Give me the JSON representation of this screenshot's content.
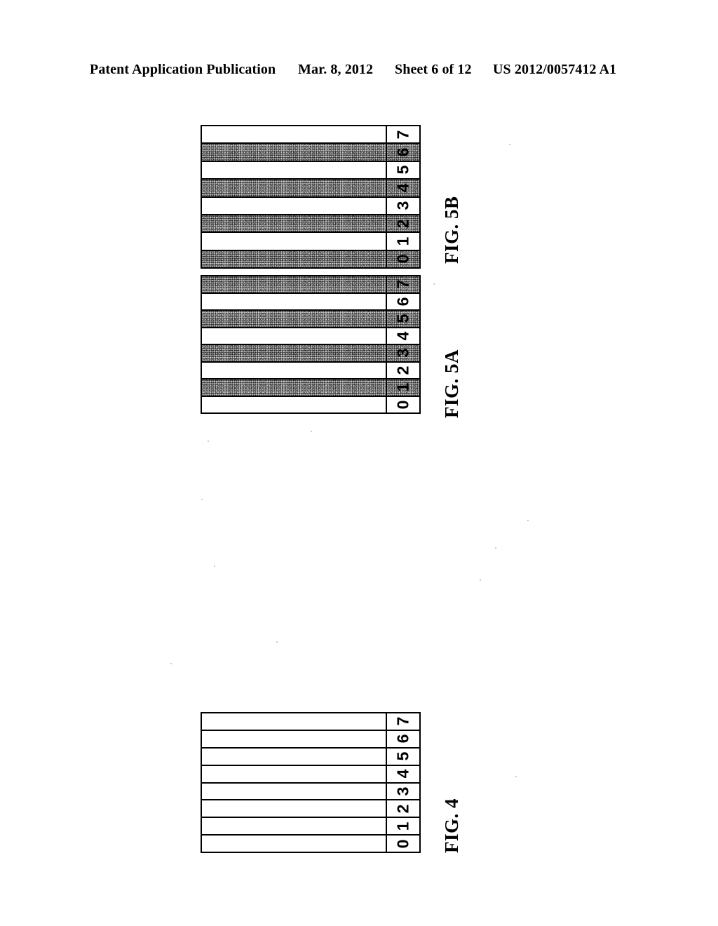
{
  "header": {
    "publication": "Patent Application Publication",
    "date": "Mar. 8, 2012",
    "sheet": "Sheet 6 of 12",
    "doc_number": "US 2012/0057412 A1"
  },
  "figures": [
    {
      "id": "fig-5b",
      "caption": "FIG. 5B",
      "rows": [
        {
          "label": "7",
          "shaded": false
        },
        {
          "label": "6",
          "shaded": true
        },
        {
          "label": "5",
          "shaded": false
        },
        {
          "label": "4",
          "shaded": true
        },
        {
          "label": "3",
          "shaded": false
        },
        {
          "label": "2",
          "shaded": true
        },
        {
          "label": "1",
          "shaded": false
        },
        {
          "label": "0",
          "shaded": true
        }
      ]
    },
    {
      "id": "fig-5a",
      "caption": "FIG. 5A",
      "rows": [
        {
          "label": "7",
          "shaded": true
        },
        {
          "label": "6",
          "shaded": false
        },
        {
          "label": "5",
          "shaded": true
        },
        {
          "label": "4",
          "shaded": false
        },
        {
          "label": "3",
          "shaded": true
        },
        {
          "label": "2",
          "shaded": false
        },
        {
          "label": "1",
          "shaded": true
        },
        {
          "label": "0",
          "shaded": false
        }
      ]
    },
    {
      "id": "fig-4",
      "caption": "FIG. 4",
      "rows": [
        {
          "label": "7",
          "shaded": false
        },
        {
          "label": "6",
          "shaded": false
        },
        {
          "label": "5",
          "shaded": false
        },
        {
          "label": "4",
          "shaded": false
        },
        {
          "label": "3",
          "shaded": false
        },
        {
          "label": "2",
          "shaded": false
        },
        {
          "label": "1",
          "shaded": false
        },
        {
          "label": "0",
          "shaded": false
        }
      ]
    }
  ],
  "colors": {
    "ink": "#000000",
    "paper": "#ffffff",
    "shading_gray": "#c9c9c9"
  }
}
